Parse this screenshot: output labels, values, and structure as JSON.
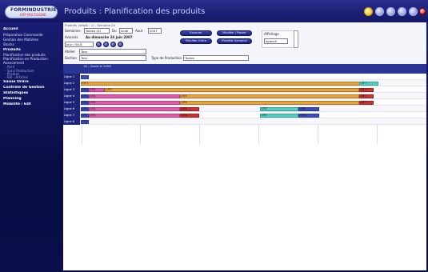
{
  "header": {
    "logo_main": "FORMINDUSTRIE",
    "logo_sub": "ERP MULTILIGNE",
    "title": "Produits : Planification des produits"
  },
  "sidebar": {
    "items": [
      {
        "label": "Accueil",
        "style": "bold"
      },
      {
        "label": "Préparation Commande",
        "style": "normal"
      },
      {
        "label": "Gestion des Matières",
        "style": "normal"
      },
      {
        "label": "Stocks",
        "style": "normal"
      },
      {
        "label": "Produits",
        "style": "bold"
      },
      {
        "label": "Planification des produits",
        "style": "normal"
      },
      {
        "label": "Planification en Production",
        "style": "normal"
      },
      {
        "label": "Avancement",
        "style": "normal"
      },
      {
        "label": "- Avril",
        "style": "sub"
      },
      {
        "label": "- Suivi Production",
        "style": "sub"
      },
      {
        "label": "- Produit",
        "style": "sub"
      },
      {
        "label": "- Bill - Articles",
        "style": "sub"
      },
      {
        "label": "Saisie Ordre",
        "style": "bold"
      },
      {
        "label": "Contrôle de Gestion",
        "style": "bold"
      },
      {
        "label": "Statistiques",
        "style": "bold"
      },
      {
        "label": "Planning",
        "style": "bold"
      },
      {
        "label": "Mobilité / EDI",
        "style": "bold"
      }
    ]
  },
  "toolbar": {
    "breadcrumb": "Produits (dépôt : 1) - Semaine 24",
    "semaines_label": "Semaines",
    "semaines_value": "Toutes (A)",
    "du_label": "Du",
    "du_value": "lundi",
    "au_label": "Aout",
    "au_value": "2007",
    "avance_label": "Avancés",
    "date_line": "Au dimanche 24 juin 2007",
    "jour_value": "Jour / Sh.8",
    "atelier_label": "Atelier",
    "atelier_value": "Tous",
    "section_label": "Section",
    "section_value": "Tous",
    "type_label": "Type de Production",
    "type_value": "Toutes",
    "btn_exporter": "Exporter",
    "btn_ajouter": "Modifier / Passer",
    "btn_rafraichir": "Planifier Ordre",
    "btn_planifier": "Planifier Semaine",
    "affichage_label": "Affichage",
    "affichage_value": "Avancé"
  },
  "gantt": {
    "month": "16 - Gantt le 2008",
    "days": [
      "LU1",
      "MA1",
      "ME1",
      "JE1",
      "VE1",
      "SA1"
    ],
    "rows": [
      "Ligne 1",
      "Ligne 2",
      "Ligne 3",
      "Ligne 4",
      "Ligne 5",
      "Ligne 6",
      "Ligne 7",
      "Ligne 8"
    ],
    "bar_labels": {
      "r2_left": "OF 1",
      "r2_right": "OF 7",
      "r3_a": "OF1",
      "r3_b": "OF2",
      "r3_c": "OF3",
      "r3_d": "OF 7",
      "r4_a": "OF1",
      "r4_b": "OF2",
      "r4_c": "OF3",
      "r4_d": "OF 7",
      "r5_a": "OF1",
      "r5_b": "OF2",
      "r5_c": "OF4",
      "r5_d": "OF 7",
      "r6_a": "OF1",
      "r6_b": "OF2",
      "r6_c": "OF4",
      "r6_d": "OF5",
      "r6_e": "OF6",
      "r7_a": "OF1",
      "r7_b": "OF2",
      "r7_c": "OF4",
      "r7_d": "OF5",
      "r7_e": "OF6",
      "r8_a": "OF1"
    }
  },
  "colors": {
    "nav_bg": "#0b0f4a",
    "gantt_header": "#2b3596",
    "bar_orange": "#e8a23a",
    "bar_pink": "#df5aa9",
    "bar_cyan": "#4fd0c2",
    "bar_blue": "#3a4cc2",
    "bar_red": "#c9322e"
  }
}
